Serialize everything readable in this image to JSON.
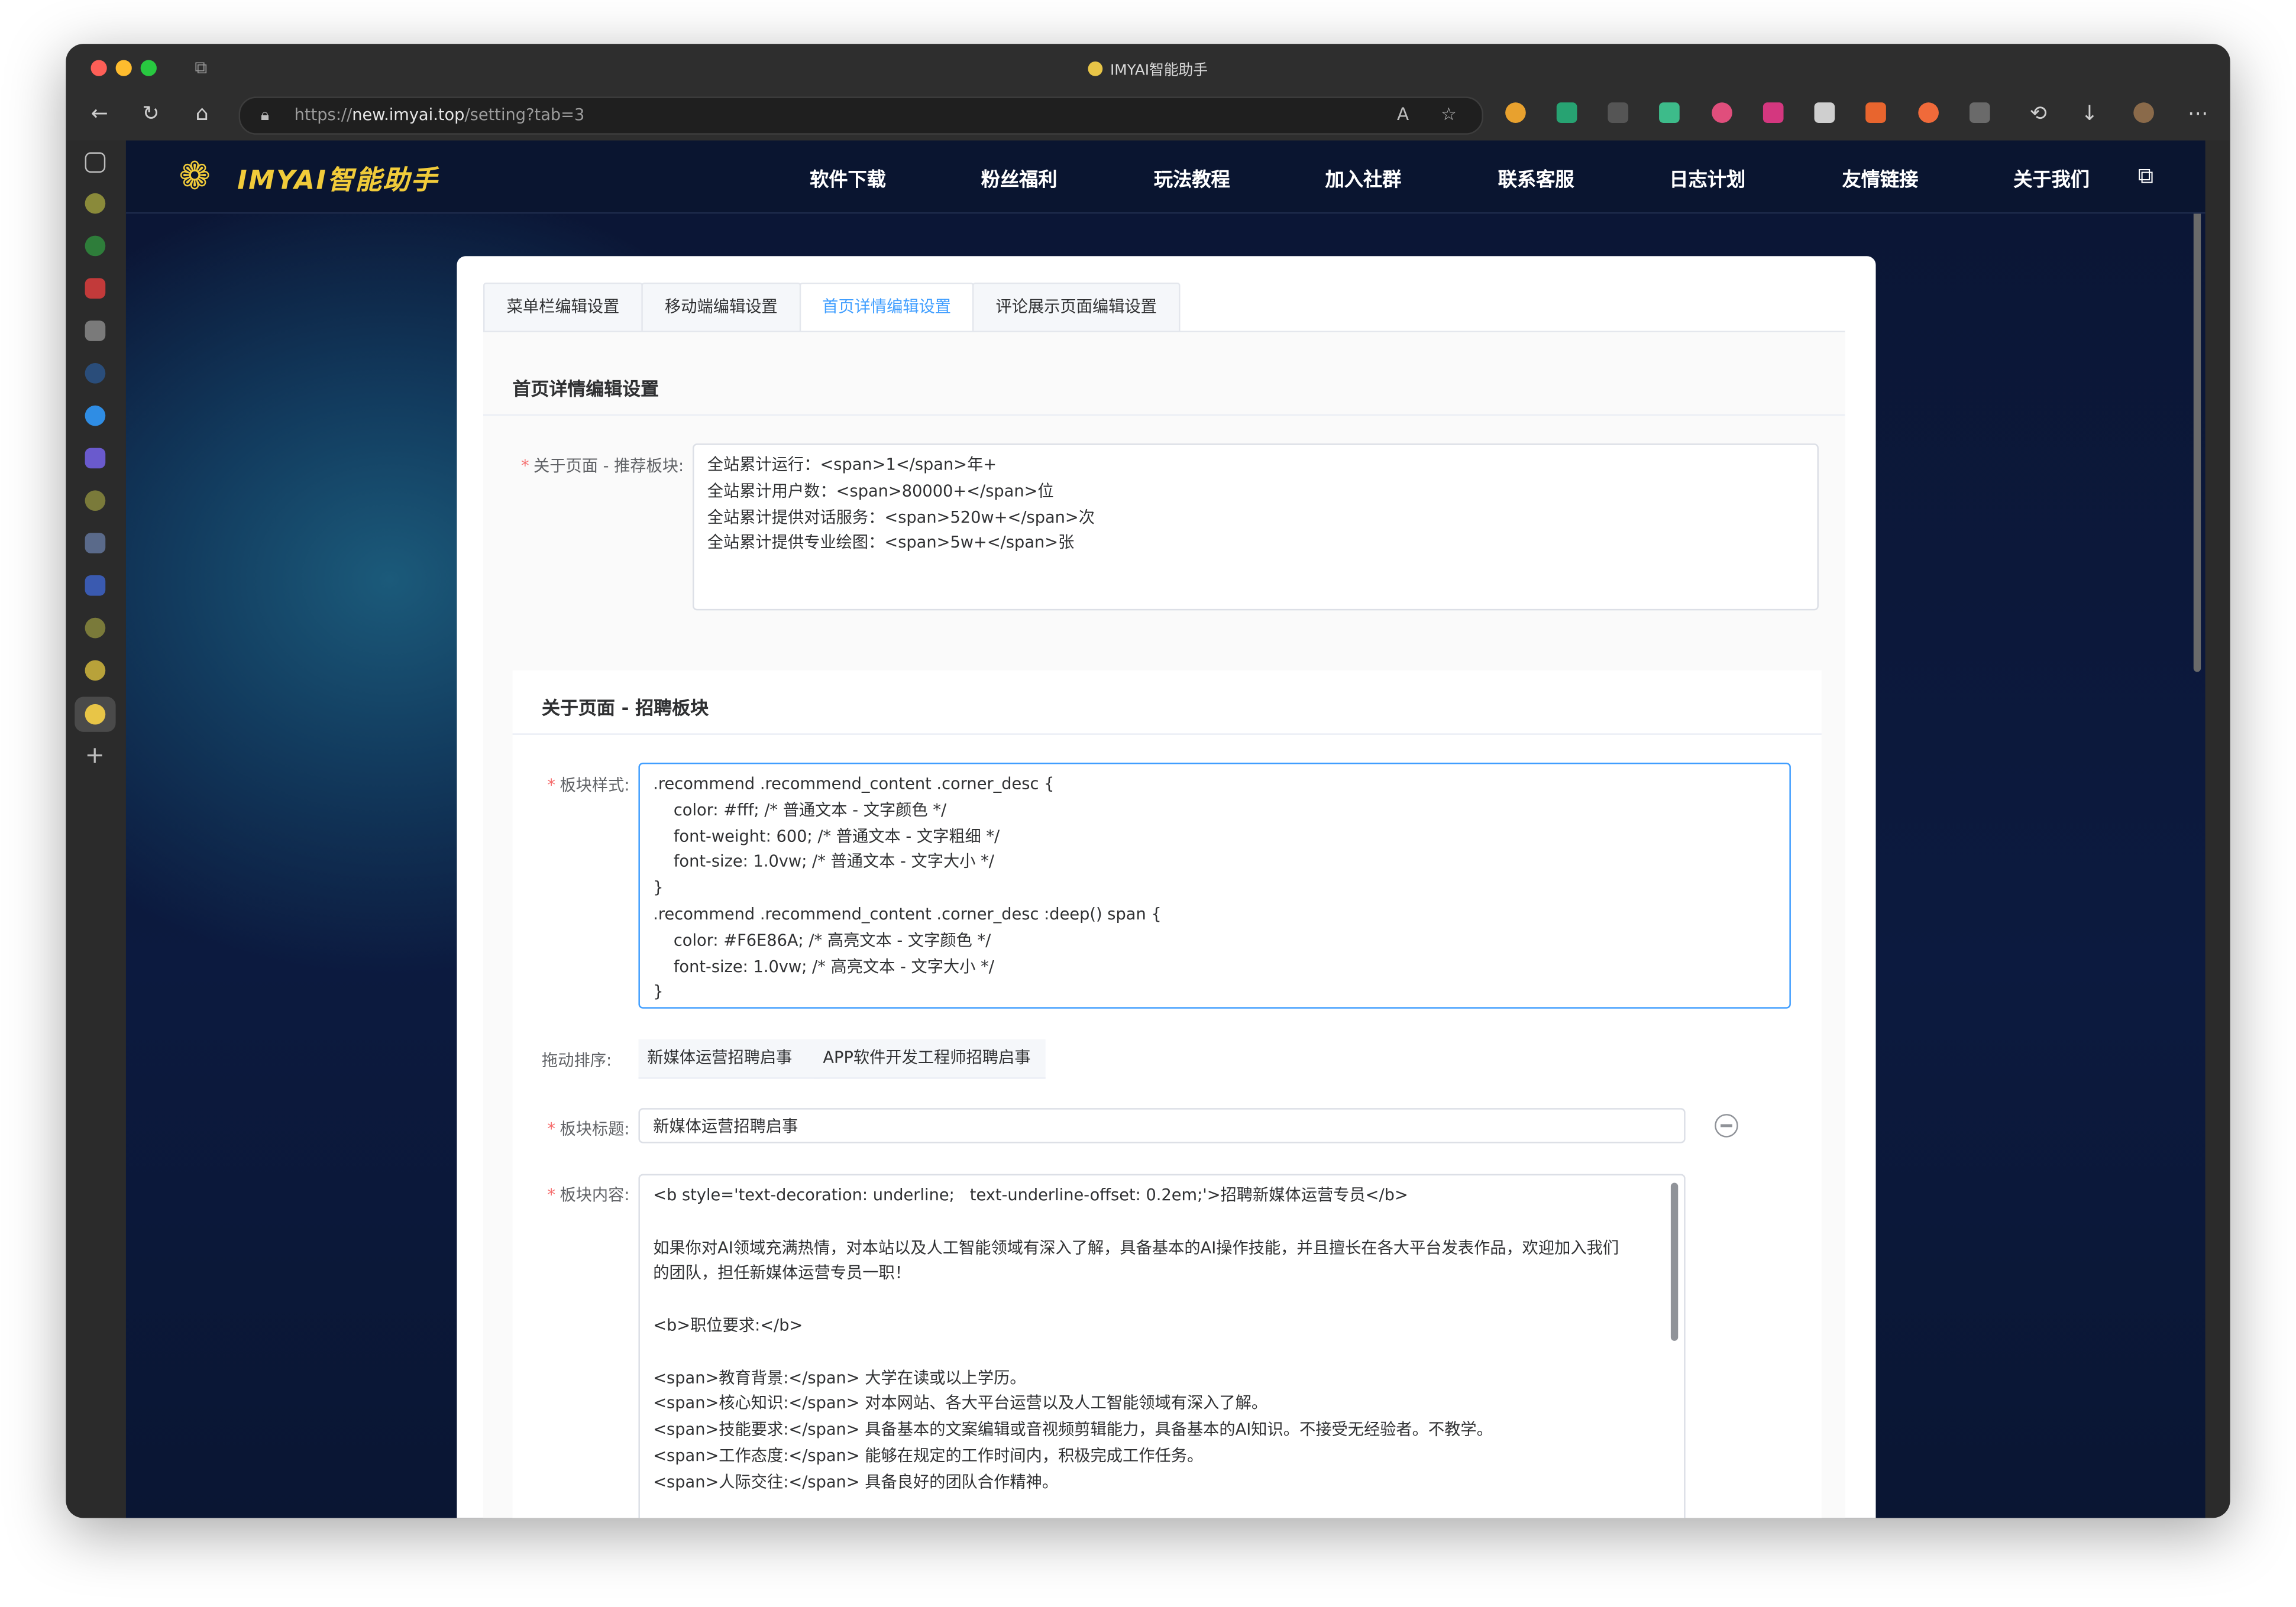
{
  "window": {
    "title": "IMYAI智能助手",
    "url_prefix": "https://",
    "url_host": "new.imyai.top",
    "url_path": "/setting?tab=3"
  },
  "site_nav": {
    "brand": "IMYAI智能助手",
    "items": [
      "软件下载",
      "粉丝福利",
      "玩法教程",
      "加入社群",
      "联系客服",
      "日志计划",
      "友情链接",
      "关于我们"
    ]
  },
  "tabs": [
    {
      "label": "菜单栏编辑设置",
      "active": false
    },
    {
      "label": "移动端编辑设置",
      "active": false
    },
    {
      "label": "首页详情编辑设置",
      "active": true
    },
    {
      "label": "评论展示页面编辑设置",
      "active": false
    }
  ],
  "section": {
    "title": "首页详情编辑设置",
    "recommend_label": "关于页面 - 推荐板块:",
    "recommend_value": "全站累计运行：<span>1</span>年+\n全站累计用户数：<span>80000+</span>位\n全站累计提供对话服务：<span>520w+</span>次\n全站累计提供专业绘图：<span>5w+</span>张"
  },
  "recruit": {
    "title": "关于页面 - 招聘板块",
    "style_label": "板块样式:",
    "style_value": ".recommend .recommend_content .corner_desc {\n    color: #fff; /* 普通文本 - 文字颜色 */\n    font-weight: 600; /* 普通文本 - 文字粗细 */\n    font-size: 1.0vw; /* 普通文本 - 文字大小 */\n}\n.recommend .recommend_content .corner_desc :deep() span {\n    color: #F6E86A; /* 高亮文本 - 文字颜色 */\n    font-size: 1.0vw; /* 高亮文本 - 文字大小 */\n}",
    "sort_label": "拖动排序:",
    "sort_items": [
      "新媒体运营招聘启事",
      "APP软件开发工程师招聘启事"
    ],
    "block_title_label": "板块标题:",
    "block_title_value": "新媒体运营招聘启事",
    "block_content_label": "板块内容:",
    "block_content_value": "<b style='text-decoration: underline;   text-underline-offset: 0.2em;'>招聘新媒体运营专员</b>\n\n如果你对AI领域充满热情，对本站以及人工智能领域有深入了解，具备基本的AI操作技能，并且擅长在各大平台发表作品，欢迎加入我们\n的团队，担任新媒体运营专员一职！\n\n<b>职位要求:</b>\n\n<span>教育背景:</span> 大学在读或以上学历。\n<span>核心知识:</span> 对本网站、各大平台运营以及人工智能领域有深入了解。\n<span>技能要求:</span> 具备基本的文案编辑或音视频剪辑能力，具备基本的AI知识。不接受无经验者。不教学。\n<span>工作态度:</span> 能够在规定的工作时间内，积极完成工作任务。\n<span>人际交往:</span> 具备良好的团队合作精神。"
  },
  "colors": {
    "accent": "#409eff",
    "brand_yellow": "#f1cb3a",
    "required": "#f56c6c"
  }
}
